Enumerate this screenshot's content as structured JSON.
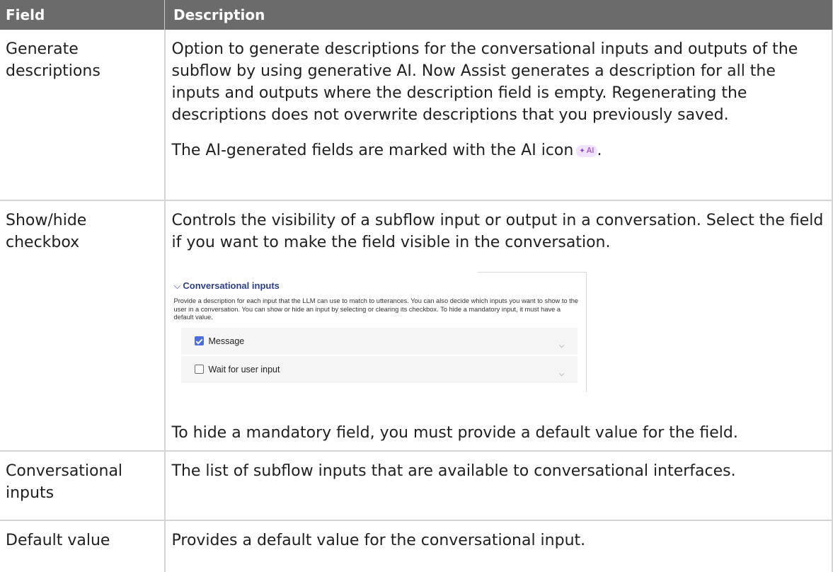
{
  "table": {
    "headers": {
      "field": "Field",
      "description": "Description"
    },
    "rows": [
      {
        "field": "Generate descriptions",
        "description_p1": "Option to generate descriptions for the conversational inputs and outputs of the subflow by using generative AI. Now Assist generates a description for all the inputs and outputs where the description field is empty. Regenerating the descriptions does not overwrite descriptions that you previously saved.",
        "description_p2": "The AI-generated fields are marked with the AI icon",
        "ai_badge": "AI",
        "description_p2_end": "."
      },
      {
        "field": "Show/hide checkbox",
        "description_p1": "Controls the visibility of a subflow input or output in a conversation. Select the field if you want to make the field visible in the conversation.",
        "description_p2": "To hide a mandatory field, you must provide a default value for the field."
      },
      {
        "field": "Conversational inputs",
        "description": "The list of subflow inputs that are available to conversational interfaces."
      },
      {
        "field": "Default value",
        "description": "Provides a default value for the conversational input."
      }
    ]
  },
  "embedded": {
    "section_title": "Conversational inputs",
    "help_text": "Provide a description for each input that the LLM can use to match to utterances. You can also decide which inputs you want to show to the user in a conversation. You can show or hide an input by selecting or clearing its checkbox. To hide a mandatory input, it must have a default value.",
    "items": [
      {
        "label": "Message",
        "checked": true
      },
      {
        "label": "Wait for user input",
        "checked": false
      }
    ]
  },
  "colors": {
    "header_bg": "#6b6b6b",
    "section_title": "#2b3f8c",
    "checkbox_checked": "#4a6edb",
    "ai_badge_bg": "#f1e3fb",
    "ai_badge_text": "#8a3fd1"
  },
  "icons": {
    "section_toggle": "chevron-down-icon",
    "item_expand": "chevron-down-icon",
    "ai_badge": "sparkle-icon"
  }
}
